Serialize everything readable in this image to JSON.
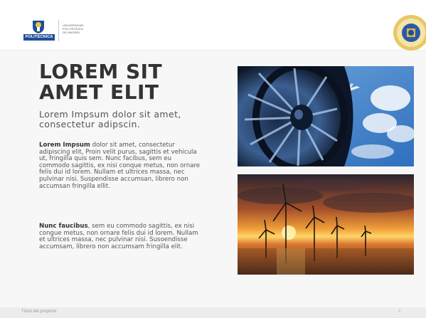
{
  "header": {
    "logo_label": "POLITÉCNICA",
    "university_lines": [
      "UNIVERSIDAD",
      "POLITÉCNICA",
      "DE MADRID"
    ]
  },
  "main": {
    "title_line1": "LOREM SIT",
    "title_line2": "AMET ELIT",
    "subtitle": "Lorem Impsum dolor sit amet, consectetur adipscin.",
    "paragraph1_bold": "Lorem Impsum",
    "paragraph1_text": " dolor sit amet, consectetur adipiscing elit, Proin velit purus, sagittis et vehicula ut, fringilla quis sem. Nunc facibus, sem eu commodo sagittis, ex nisi conque metus, non ornare felis dui id lorem. Nullam et ultrices massa, nec pulvinar nisi. Suspendisse accumsan, librero non accumsan fringilla ellit.",
    "paragraph2_bold": "Nunc faucibus",
    "paragraph2_text": ", sem eu commodo sagittis, ex nisi congue metus, non ornare felis dui id lorem. Nullam et ultrices massa, nec pulvinar nisi. Susoendisse accumsam, librero non accumsam fringilla elit."
  },
  "images": {
    "top": "jet-engine-and-airplane-photo",
    "bottom": "offshore-wind-turbines-sunset-photo"
  },
  "footer": {
    "text": "Título del proyecto",
    "page_number": "2"
  },
  "colors": {
    "brand_blue": "#1f4e96",
    "title": "#333333",
    "body_text": "#555555"
  }
}
